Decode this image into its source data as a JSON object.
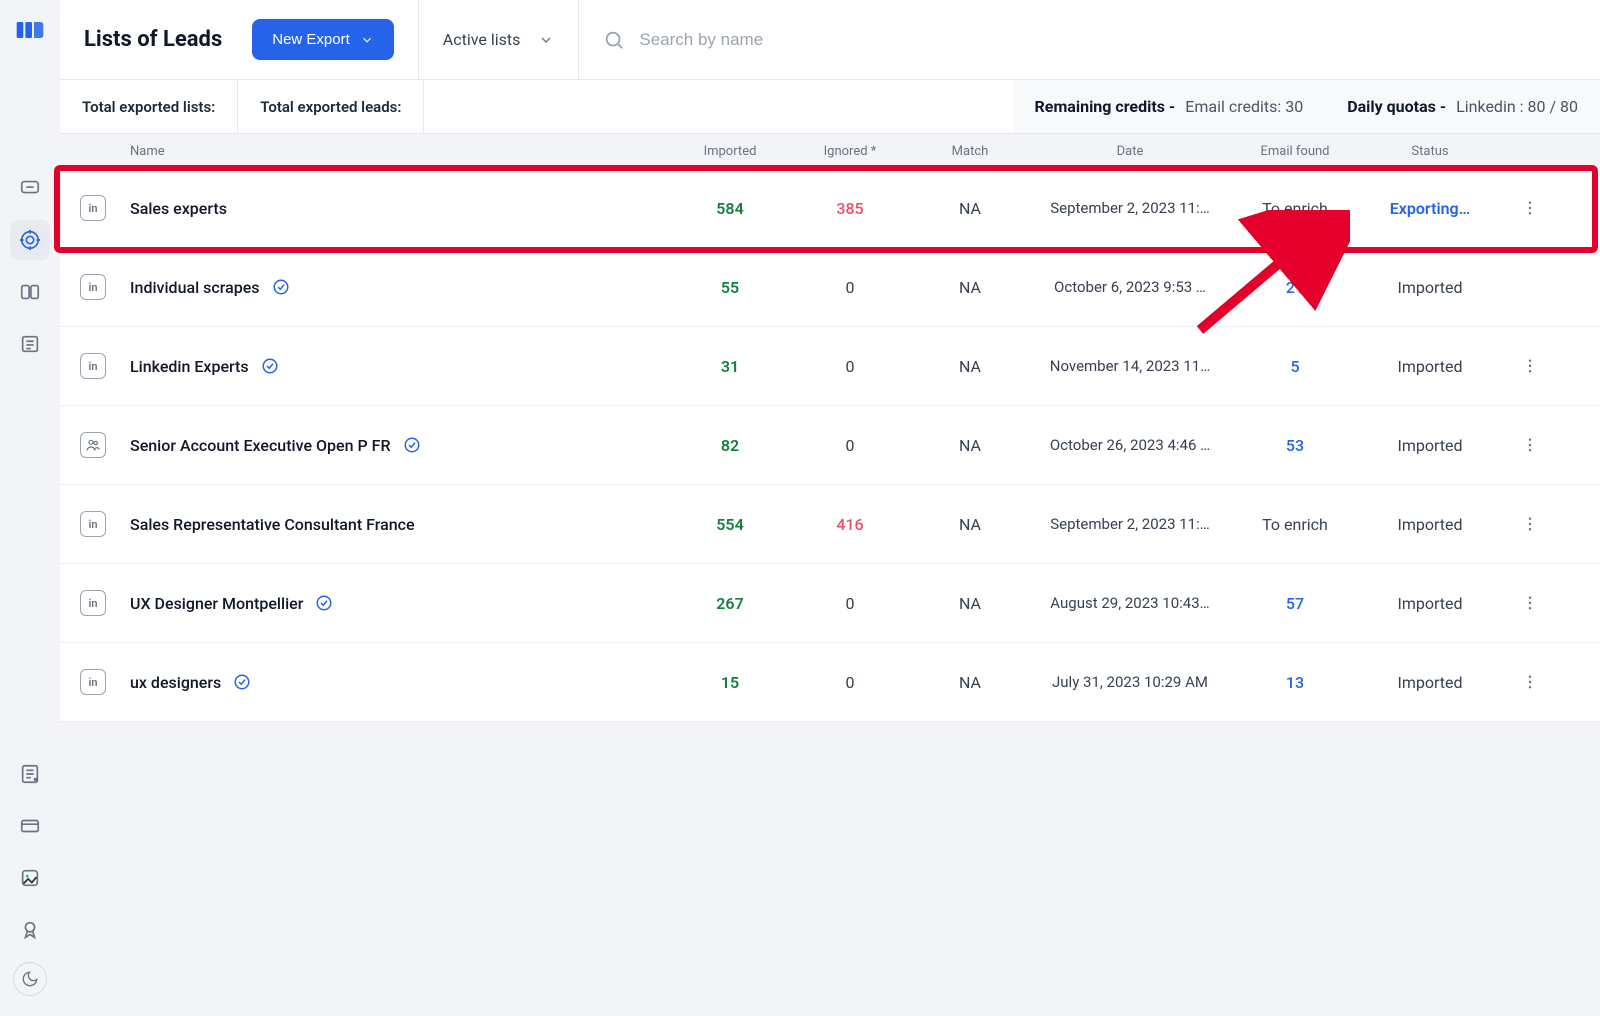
{
  "header": {
    "title": "Lists of Leads",
    "new_export_label": "New Export",
    "filter_label": "Active lists",
    "search_placeholder": "Search by name"
  },
  "stats": {
    "total_lists_label": "Total exported lists:",
    "total_leads_label": "Total exported leads:",
    "remaining_label": "Remaining credits -",
    "remaining_value": "Email credits: 30",
    "quota_label": "Daily quotas -",
    "quota_value": "Linkedin : 80 / 80"
  },
  "columns": {
    "name": "Name",
    "imported": "Imported",
    "ignored": "Ignored *",
    "match": "Match",
    "date": "Date",
    "email_found": "Email found",
    "status": "Status"
  },
  "rows": [
    {
      "icon": "in",
      "name": "Sales experts",
      "verified": false,
      "imported": "584",
      "ignored": "385",
      "ignored_red": true,
      "match": "NA",
      "date": "September 2, 2023 11:…",
      "email_found": "To enrich",
      "email_found_link": false,
      "status": "Exporting…",
      "status_link": true,
      "has_more": true
    },
    {
      "icon": "in",
      "name": "Individual scrapes",
      "verified": true,
      "imported": "55",
      "ignored": "0",
      "ignored_red": false,
      "match": "NA",
      "date": "October 6, 2023 9:53 …",
      "email_found": "21",
      "email_found_link": true,
      "status": "Imported",
      "status_link": false,
      "has_more": false
    },
    {
      "icon": "in",
      "name": "Linkedin Experts",
      "verified": true,
      "imported": "31",
      "ignored": "0",
      "ignored_red": false,
      "match": "NA",
      "date": "November 14, 2023 11…",
      "email_found": "5",
      "email_found_link": true,
      "status": "Imported",
      "status_link": false,
      "has_more": true
    },
    {
      "icon": "people",
      "name": "Senior Account Executive Open P FR",
      "verified": true,
      "imported": "82",
      "ignored": "0",
      "ignored_red": false,
      "match": "NA",
      "date": "October 26, 2023 4:46 …",
      "email_found": "53",
      "email_found_link": true,
      "status": "Imported",
      "status_link": false,
      "has_more": true
    },
    {
      "icon": "in",
      "name": "Sales Representative Consultant France",
      "verified": false,
      "imported": "554",
      "ignored": "416",
      "ignored_red": true,
      "match": "NA",
      "date": "September 2, 2023 11:…",
      "email_found": "To enrich",
      "email_found_link": false,
      "status": "Imported",
      "status_link": false,
      "has_more": true
    },
    {
      "icon": "in",
      "name": "UX Designer Montpellier",
      "verified": true,
      "imported": "267",
      "ignored": "0",
      "ignored_red": false,
      "match": "NA",
      "date": "August 29, 2023 10:43…",
      "email_found": "57",
      "email_found_link": true,
      "status": "Imported",
      "status_link": false,
      "has_more": true
    },
    {
      "icon": "in",
      "name": "ux designers",
      "verified": true,
      "imported": "15",
      "ignored": "0",
      "ignored_red": false,
      "match": "NA",
      "date": "July 31, 2023 10:29 AM",
      "email_found": "13",
      "email_found_link": true,
      "status": "Imported",
      "status_link": false,
      "has_more": true
    }
  ]
}
